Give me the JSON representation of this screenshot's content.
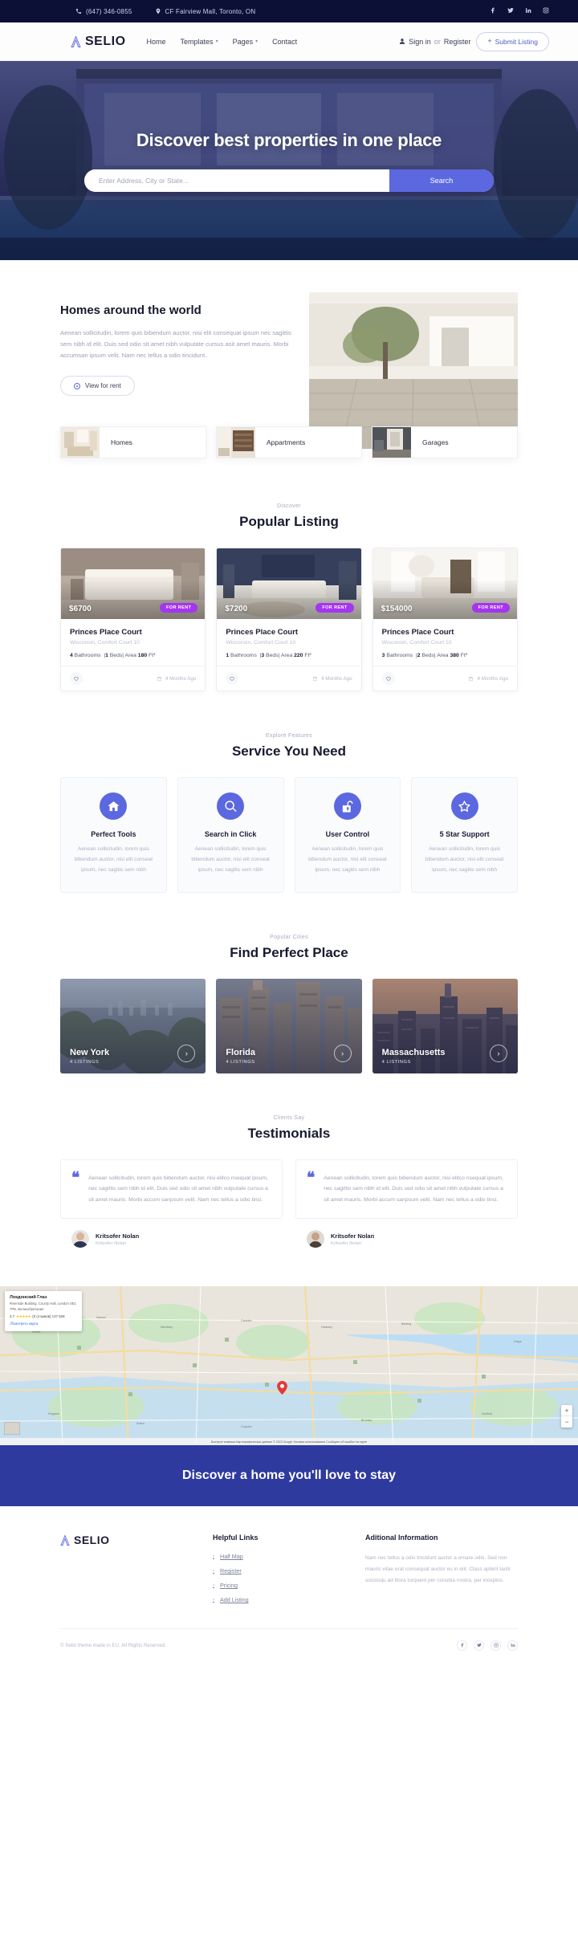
{
  "topbar": {
    "phone": "(647) 346-0855",
    "address": "CF Fairview Mall, Toronto, ON",
    "socials": [
      "facebook-icon",
      "twitter-icon",
      "linkedin-icon",
      "instagram-icon"
    ]
  },
  "nav": {
    "brand": "SELIO",
    "links": [
      {
        "label": "Home",
        "caret": false
      },
      {
        "label": "Templates",
        "caret": true
      },
      {
        "label": "Pages",
        "caret": true
      },
      {
        "label": "Contact",
        "caret": false
      }
    ],
    "sign_in": "Sign in",
    "or": "or",
    "register": "Register",
    "submit_listing": "Submit Listing"
  },
  "hero": {
    "title": "Discover best properties in one place",
    "search_placeholder": "Enter Address, City or State...",
    "search_button": "Search"
  },
  "homes": {
    "title": "Homes around the world",
    "body": "Aenean sollicitudin, lorem quis bibendum auctor, nisi elit consequat ipsum nec sagittis sem nibh id elit. Duis sed odio sit amet nibh vulputate cursus asit amet mauris. Morbi accumsan ipsum velit. Nam nec tellus a odio tincidunt.",
    "cta": "View for rent",
    "categories": [
      {
        "label": "Homes"
      },
      {
        "label": "Appartments"
      },
      {
        "label": "Garages"
      }
    ]
  },
  "listing": {
    "kicker": "Discover",
    "title": "Popular Listing",
    "cards": [
      {
        "price": "$6700",
        "tag": "FOR RENT",
        "title": "Princes Place Court",
        "sub": "Wisconsin, Comfort Court 10",
        "bathrooms": "4",
        "beds": "1",
        "area": "180",
        "unit": "Ft²",
        "ago": "4 Months Ago"
      },
      {
        "price": "$7200",
        "tag": "FOR RENT",
        "title": "Princes Place Court",
        "sub": "Wisconsin, Comfort Court 10",
        "bathrooms": "1",
        "beds": "3",
        "area": "220",
        "unit": "Ft²",
        "ago": "4 Months Ago"
      },
      {
        "price": "$154000",
        "tag": "FOR RENT",
        "title": "Princes Place Court",
        "sub": "Wisconsin, Comfort Court 10",
        "bathrooms": "3",
        "beds": "2",
        "area": "380",
        "unit": "Ft²",
        "ago": "4 Months Ago"
      }
    ],
    "labels": {
      "bathrooms": "Bathrooms",
      "beds": "Beds",
      "area": "Area"
    }
  },
  "service": {
    "kicker": "Explore Features",
    "title": "Service You Need",
    "items": [
      {
        "icon": "home-icon",
        "name": "Perfect Tools",
        "desc": "Aenean sollicitudin, lorem quis bibendum auctor, nisi elit conseat ipsum, nec sagitis sem nibh"
      },
      {
        "icon": "search-icon",
        "name": "Search in Click",
        "desc": "Aenean sollicitudin, lorem quis bibendum auctor, nisi elit conseat ipsum, nec sagitis sem nibh"
      },
      {
        "icon": "lock-open-icon",
        "name": "User Control",
        "desc": "Aenean sollicitudin, lorem quis bibendum auctor, nisi elit conseat ipsum, nec sagitis sem nibh"
      },
      {
        "icon": "star-icon",
        "name": "5 Star Support",
        "desc": "Aenean sollicitudin, lorem quis bibendum auctor, nisi elit conseat ipsum, nec sagitis sem nibh"
      }
    ]
  },
  "cities": {
    "kicker": "Popular Cities",
    "title": "Find Perfect Place",
    "items": [
      {
        "name": "New York",
        "count": "4 LISTINGS"
      },
      {
        "name": "Florida",
        "count": "4 LISTINGS"
      },
      {
        "name": "Massachusetts",
        "count": "4 LISTINGS"
      }
    ]
  },
  "testimonials": {
    "kicker": "Clients Say",
    "title": "Testimonials",
    "items": [
      {
        "quote": "Aenean sollicitudin, lorem quis bibendum auctor, nisi elitco nsequat ipsum, nec sagittis sem nibh id elit. Duis sed odio sit amet nibh vulputate cursus a sit amet mauris. Morbi accum sanpsum velit. Nam nec tellus a odio tinci.",
        "name": "Kritsofer Nolan",
        "role": "Kritsofer Nolan"
      },
      {
        "quote": "Aenean sollicitudin, lorem quis bibendum auctor, nisi elitco nsequat ipsum, nec sagittis sem nibh id elit. Duis sed odio sit amet nibh vulputate cursus a sit amet mauris. Morbi accum sanpsum velit. Nam nec tellus a odio tinci.",
        "name": "Kritsofer Nolan",
        "role": "Kritsofer Nolan"
      }
    ]
  },
  "map": {
    "place_title": "Локдонский Глаз",
    "place_sub": "Riverside Building, County Hall, London SE1 7PB, Великобритания",
    "rating": "4.7",
    "reviews": "(0 отзывов) 137 528",
    "link": "টেсмотреть карта",
    "zoom_in": "+",
    "zoom_out": "−",
    "attribution": "Быстрые клавиши   Картографические данные © 2023   Google   Условия использования   Сообщить об ошибке на карте"
  },
  "cta": {
    "title": "Discover a home you'll love to stay"
  },
  "footer": {
    "brand": "SELIO",
    "helpful_title": "Helpful Links",
    "helpful_links": [
      "Half Map",
      "Register",
      "Pricing",
      "Add Listing"
    ],
    "additional_title": "Aditional Information",
    "additional_text": "Nam nec tellus a odio tincidunt auctor a ornare odio. Sed non mauris vitae erat consequat auctor eu in elit. Class aptent taciti sociosqu ad litora torquent per conubia nostra, per inceptos.",
    "copyright": "© Selio theme made in EU. All Rights Reserved.",
    "socials": [
      "facebook-icon",
      "twitter-icon",
      "instagram-icon",
      "linkedin-icon"
    ]
  },
  "colors": {
    "dark_navy": "#0c1037",
    "accent": "#5b68e0",
    "tag_purple": "#a435f0",
    "cta_blue": "#2e3a9e"
  }
}
